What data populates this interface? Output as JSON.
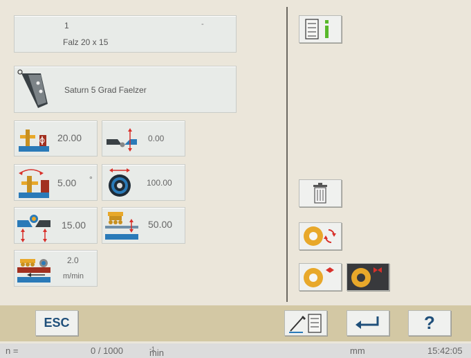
{
  "job": {
    "number": "1",
    "dash": "-",
    "name": "Falz 20 x 15"
  },
  "tool": {
    "name": "Saturn 5 Grad Faelzer"
  },
  "params": {
    "height": "20.00",
    "offset": "0.00",
    "angle": "5.00",
    "angle_unit": "°",
    "tool_diameter": "100.00",
    "depth": "15.00",
    "pressure": "50.00",
    "feed_value": "2.0",
    "feed_unit": "m/min"
  },
  "footer": {
    "esc_label": "ESC",
    "help_label": "?"
  },
  "status": {
    "n_label": "n =",
    "rpm_value": "0 / 1000",
    "rpm_unit": "min",
    "rpm_exp": "-1",
    "unit": "mm",
    "time": "15:42:05"
  },
  "colors": {
    "accent_orange": "#e8a82a",
    "accent_red": "#d8302a",
    "accent_blue": "#2a7ab8"
  }
}
